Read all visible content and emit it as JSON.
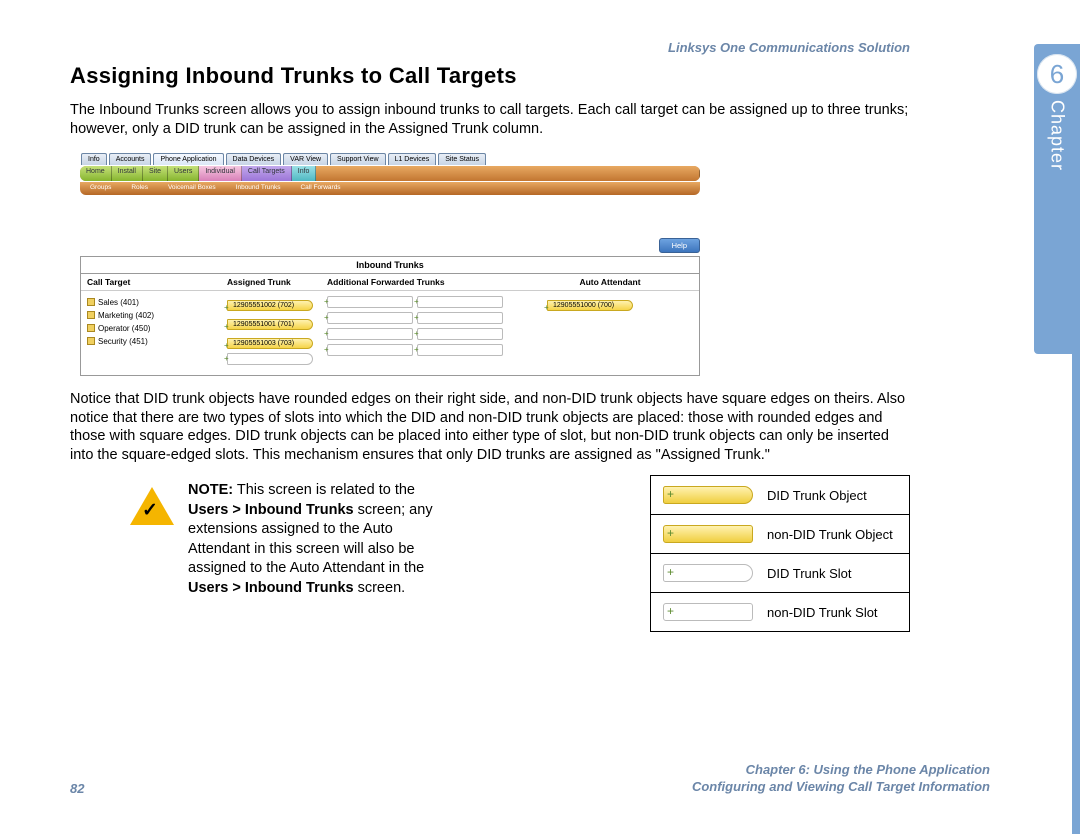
{
  "header": {
    "product": "Linksys One Communications Solution"
  },
  "chapter": {
    "number": "6",
    "label": "Chapter"
  },
  "title": "Assigning Inbound Trunks to Call Targets",
  "intro": "The Inbound Trunks screen allows you to assign inbound trunks to call targets. Each call target can be assigned up to three trunks; however, only a DID trunk can be assigned in the Assigned Trunk column.",
  "topTabs": {
    "items": [
      "Info",
      "Accounts",
      "Phone Application",
      "Data Devices",
      "VAR View",
      "Support View",
      "L1 Devices",
      "Site Status"
    ]
  },
  "navBar": {
    "items": [
      "Home",
      "Install",
      "Site",
      "Users",
      "Individual",
      "Call Targets",
      "Info"
    ]
  },
  "subBar": {
    "items": [
      "Groups",
      "Roles",
      "Voicemail Boxes",
      "Inbound Trunks",
      "Call Forwards"
    ]
  },
  "helpLabel": "Help",
  "trunkPanel": {
    "title": "Inbound Trunks",
    "columns": {
      "callTarget": "Call Target",
      "assigned": "Assigned Trunk",
      "additional": "Additional Forwarded Trunks",
      "auto": "Auto Attendant"
    },
    "callTargets": [
      "Sales (401)",
      "Marketing (402)",
      "Operator (450)",
      "Security (451)"
    ],
    "assignedTrunks": [
      "12905551002 (702)",
      "12905551001 (701)",
      "12905551003 (703)"
    ],
    "autoAttendant": "12905551000 (700)"
  },
  "body2": "Notice that DID trunk objects have rounded edges on their right side, and non-DID trunk objects have square edges on theirs. Also notice that there are two types of slots into which the DID and non-DID trunk objects are placed: those with rounded edges and those with square edges. DID trunk objects can be placed into either type of slot, but non-DID trunk objects can only be inserted into the square-edged slots. This mechanism ensures that only DID trunks are assigned as \"Assigned Trunk.\"",
  "note": {
    "boldPrefix": "NOTE:",
    "line1a": " This screen is related to the ",
    "bold1": "Users > Inbound Trunks",
    "line1b": " screen; any extensions assigned to the Auto Attendant in this screen will also be assigned to the Auto Attendant in the ",
    "bold2": "Users > Inbound Trunks",
    "line1c": " screen."
  },
  "legend": {
    "rows": [
      {
        "label": "DID Trunk Object"
      },
      {
        "label": "non-DID Trunk Object"
      },
      {
        "label": "DID Trunk Slot"
      },
      {
        "label": "non-DID Trunk Slot"
      }
    ]
  },
  "footer": {
    "page": "82",
    "line1": "Chapter 6: Using the Phone Application",
    "line2": "Configuring and Viewing Call Target Information"
  }
}
